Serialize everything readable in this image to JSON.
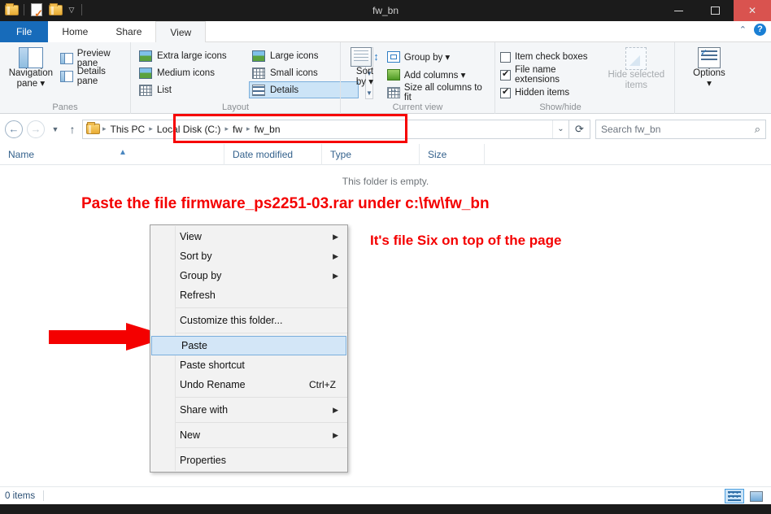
{
  "window": {
    "title": "fw_bn",
    "quick_access": [
      "folder-icon",
      "separator",
      "properties-icon",
      "new-folder-icon",
      "customize-chevron-icon"
    ],
    "controls": {
      "minimize": "minimize-button",
      "maximize": "maximize-button",
      "close": "✕"
    }
  },
  "ribbon": {
    "tabs": [
      {
        "label": "File",
        "active": false,
        "kind": "file"
      },
      {
        "label": "Home",
        "active": false,
        "kind": "normal"
      },
      {
        "label": "Share",
        "active": false,
        "kind": "normal"
      },
      {
        "label": "View",
        "active": true,
        "kind": "normal"
      }
    ],
    "collapse_label": "⌃",
    "help_label": "?",
    "groups": [
      {
        "label": "Panes",
        "big_button": {
          "line1": "Navigation",
          "line2": "pane ▾"
        },
        "items": [
          "Preview pane",
          "Details pane"
        ]
      },
      {
        "label": "Layout",
        "items": [
          {
            "label": "Extra large icons",
            "selected": false
          },
          {
            "label": "Large icons",
            "selected": false
          },
          {
            "label": "Medium icons",
            "selected": false
          },
          {
            "label": "Small icons",
            "selected": false
          },
          {
            "label": "List",
            "selected": false
          },
          {
            "label": "Details",
            "selected": true
          }
        ]
      },
      {
        "label": "Current view",
        "big_button": {
          "line1": "Sort",
          "line2": "by ▾"
        },
        "items": [
          "Group by ▾",
          "Add columns ▾",
          "Size all columns to fit"
        ]
      },
      {
        "label": "Show/hide",
        "checks": [
          {
            "label": "Item check boxes",
            "checked": false
          },
          {
            "label": "File name extensions",
            "checked": true
          },
          {
            "label": "Hidden items",
            "checked": true
          }
        ],
        "hide_selected": {
          "line1": "Hide selected",
          "line2": "items"
        }
      },
      {
        "label": "",
        "options": {
          "line1": "Options",
          "line2": "▾"
        }
      }
    ]
  },
  "navbar": {
    "back": "back-button",
    "forward": "forward-button",
    "recent": "recent-locations-dropdown",
    "up": "up-one-level-button",
    "breadcrumbs": [
      "This PC",
      "Local Disk (C:)",
      "fw",
      "fw_bn"
    ],
    "dropdown": "⌄",
    "refresh": "⟳",
    "highlight_color": "#f60000"
  },
  "search": {
    "placeholder": "Search fw_bn",
    "value": "",
    "icon": "search-icon"
  },
  "columns": [
    {
      "key": "name",
      "label": "Name",
      "sorted": true
    },
    {
      "key": "date",
      "label": "Date modified",
      "sorted": false
    },
    {
      "key": "type",
      "label": "Type",
      "sorted": false
    },
    {
      "key": "size",
      "label": "Size",
      "sorted": false
    }
  ],
  "file_list": {
    "rows": [],
    "empty_message": "This folder is empty."
  },
  "annotations": [
    {
      "id": "paste-instruction",
      "text": "Paste the file firmware_ps2251-03.rar under c:\\fw\\fw_bn",
      "color": "#f40000"
    },
    {
      "id": "file-six-note",
      "text": "It's file Six on top of the page",
      "color": "#f40000"
    },
    {
      "id": "paste-arrow",
      "text": "",
      "color": "#f40000"
    }
  ],
  "context_menu": {
    "items": [
      {
        "label": "View",
        "submenu": true,
        "accel": "",
        "selected": false,
        "separator_after": false
      },
      {
        "label": "Sort by",
        "submenu": true,
        "accel": "",
        "selected": false,
        "separator_after": false
      },
      {
        "label": "Group by",
        "submenu": true,
        "accel": "",
        "selected": false,
        "separator_after": false
      },
      {
        "label": "Refresh",
        "submenu": false,
        "accel": "",
        "selected": false,
        "separator_after": true
      },
      {
        "label": "Customize this folder...",
        "submenu": false,
        "accel": "",
        "selected": false,
        "separator_after": true
      },
      {
        "label": "Paste",
        "submenu": false,
        "accel": "",
        "selected": true,
        "separator_after": false
      },
      {
        "label": "Paste shortcut",
        "submenu": false,
        "accel": "",
        "selected": false,
        "separator_after": false
      },
      {
        "label": "Undo Rename",
        "submenu": false,
        "accel": "Ctrl+Z",
        "selected": false,
        "separator_after": true
      },
      {
        "label": "Share with",
        "submenu": true,
        "accel": "",
        "selected": false,
        "separator_after": true
      },
      {
        "label": "New",
        "submenu": true,
        "accel": "",
        "selected": false,
        "separator_after": true
      },
      {
        "label": "Properties",
        "submenu": false,
        "accel": "",
        "selected": false,
        "separator_after": false
      }
    ]
  },
  "statusbar": {
    "item_count": "0 items",
    "view_buttons": [
      {
        "name": "details-view-button",
        "active": true
      },
      {
        "name": "large-icons-view-button",
        "active": false
      }
    ]
  }
}
